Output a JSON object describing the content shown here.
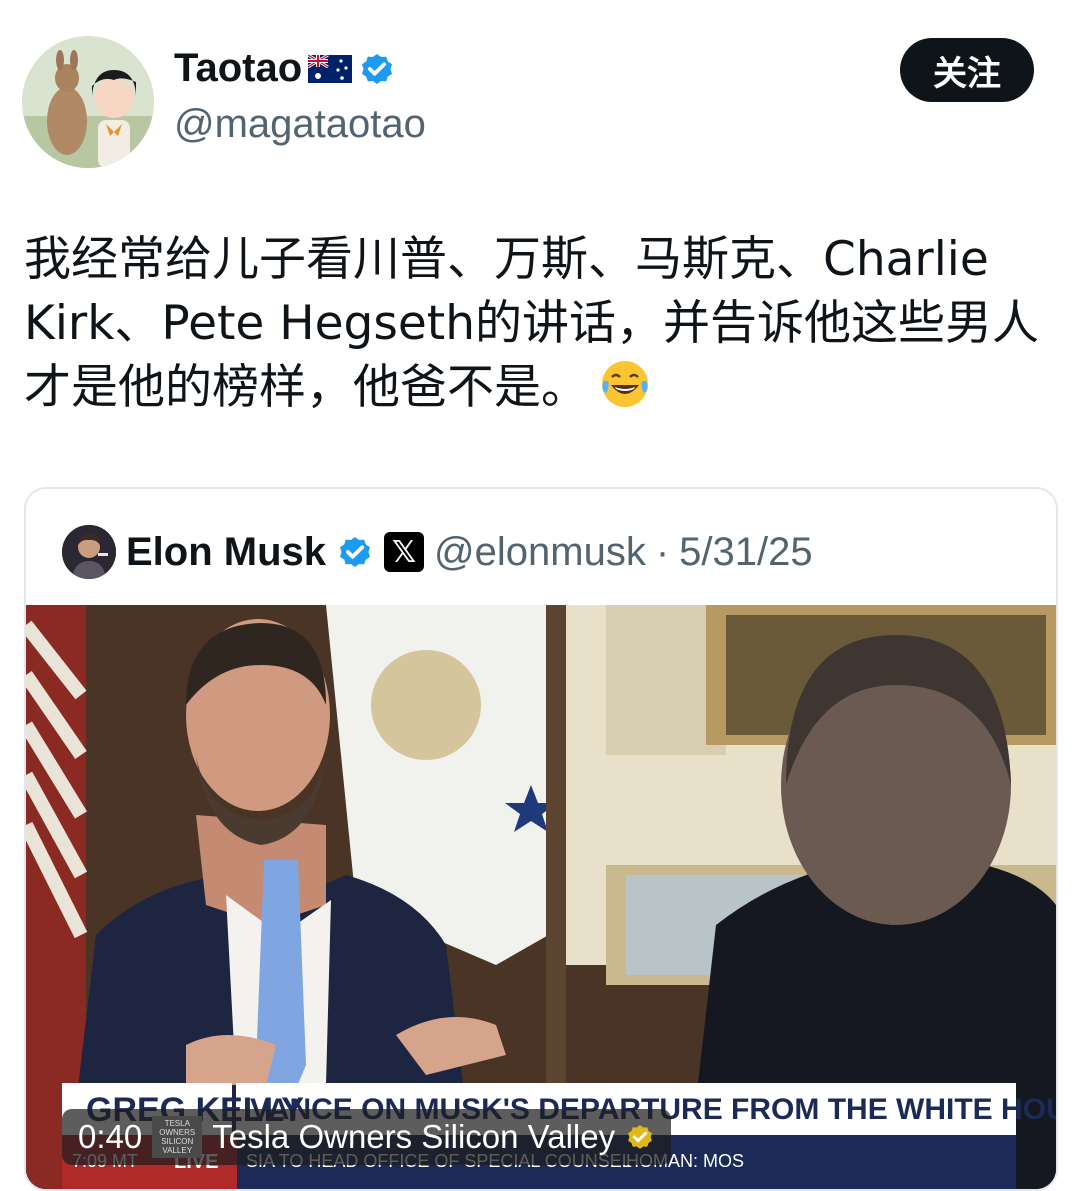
{
  "author": {
    "display_name": "Taotao",
    "handle": "@magataotao",
    "flag_icon": "australia-flag-icon",
    "verified_icon": "verified-badge-icon",
    "verified_color": "#1d9bf0"
  },
  "follow_button": {
    "label": "关注"
  },
  "tweet": {
    "lines": [
      "我经常给儿子看川普、万斯、马斯克、Charlie",
      "Kirk、Pete Hegseth的讲话，并告诉他这些男人",
      "才是他的榜样，他爸不是。"
    ],
    "emoji": "laughing-tears-emoji"
  },
  "quoted_post": {
    "display_name": "Elon Musk",
    "verified_icon": "verified-badge-icon",
    "affiliate_badge": "𝕏",
    "handle": "@elonmusk",
    "separator": "·",
    "date": "5/31/25",
    "video": {
      "lower_third_name": "GREG KELLY",
      "headline": "VANCE ON MUSK'S DEPARTURE FROM THE WHITE HOUSE",
      "time_code": "7:09 MT",
      "live_label": "LIVE",
      "ticker": "SIA TO HEAD OFFICE OF SPECIAL COUNSEL",
      "ticker2": "HOMAN: MOS",
      "duration": "0:40",
      "channel": "Tesla Owners Silicon Valley",
      "channel_logo": "TESLA OWNERS SILICON VALLEY"
    }
  }
}
